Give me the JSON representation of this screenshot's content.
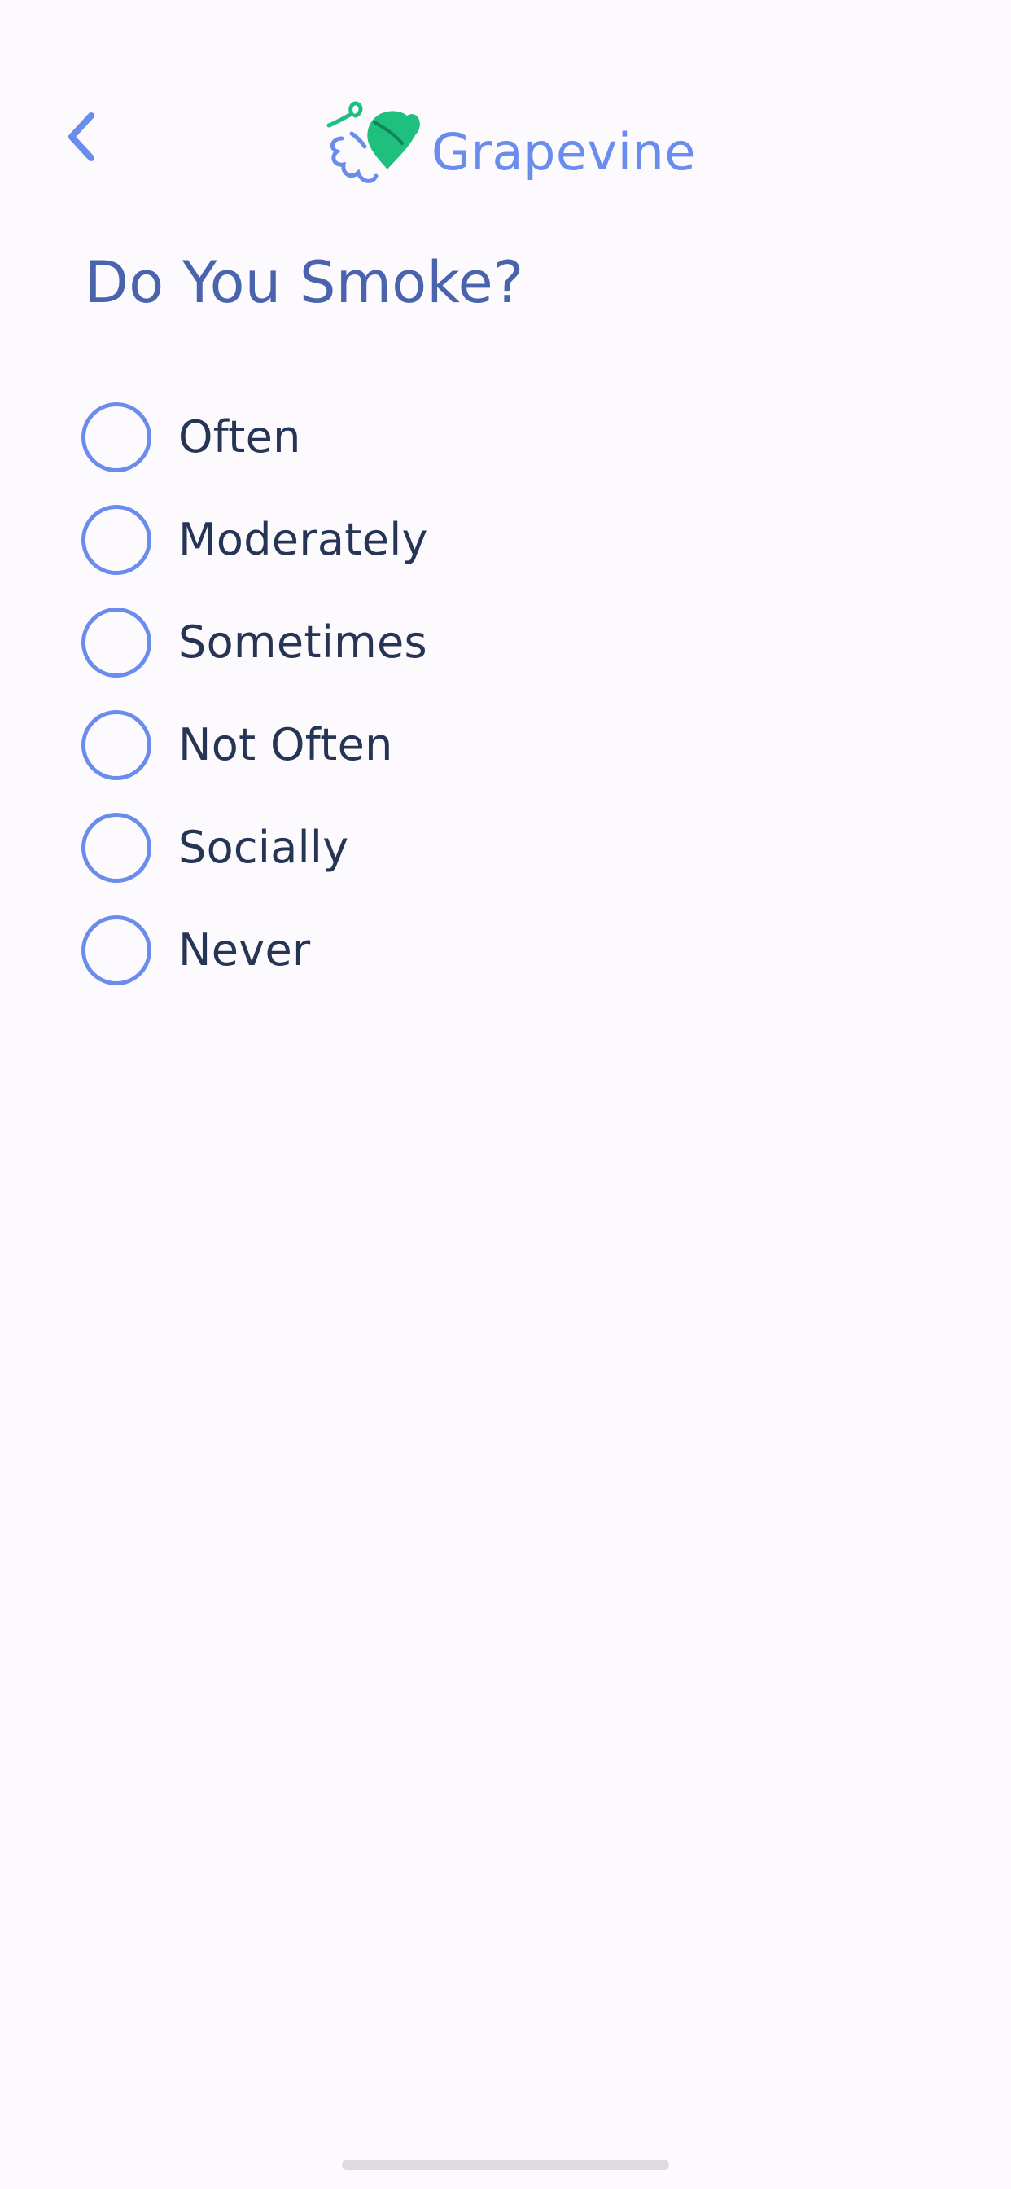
{
  "header": {
    "back_icon": "chevron-left-icon",
    "logo_icon": "grape-leaf-icon",
    "logo_text": "Grapevine"
  },
  "question": {
    "title": "Do You Smoke?"
  },
  "options": [
    {
      "label": "Often",
      "selected": false
    },
    {
      "label": "Moderately",
      "selected": false
    },
    {
      "label": "Sometimes",
      "selected": false
    },
    {
      "label": "Not Often",
      "selected": false
    },
    {
      "label": "Socially",
      "selected": false
    },
    {
      "label": "Never",
      "selected": false
    }
  ],
  "colors": {
    "background": "#fdfafd",
    "accent": "#6a8cec",
    "title": "#4a63ad",
    "text": "#263556",
    "leaf": "#1fbf80"
  }
}
